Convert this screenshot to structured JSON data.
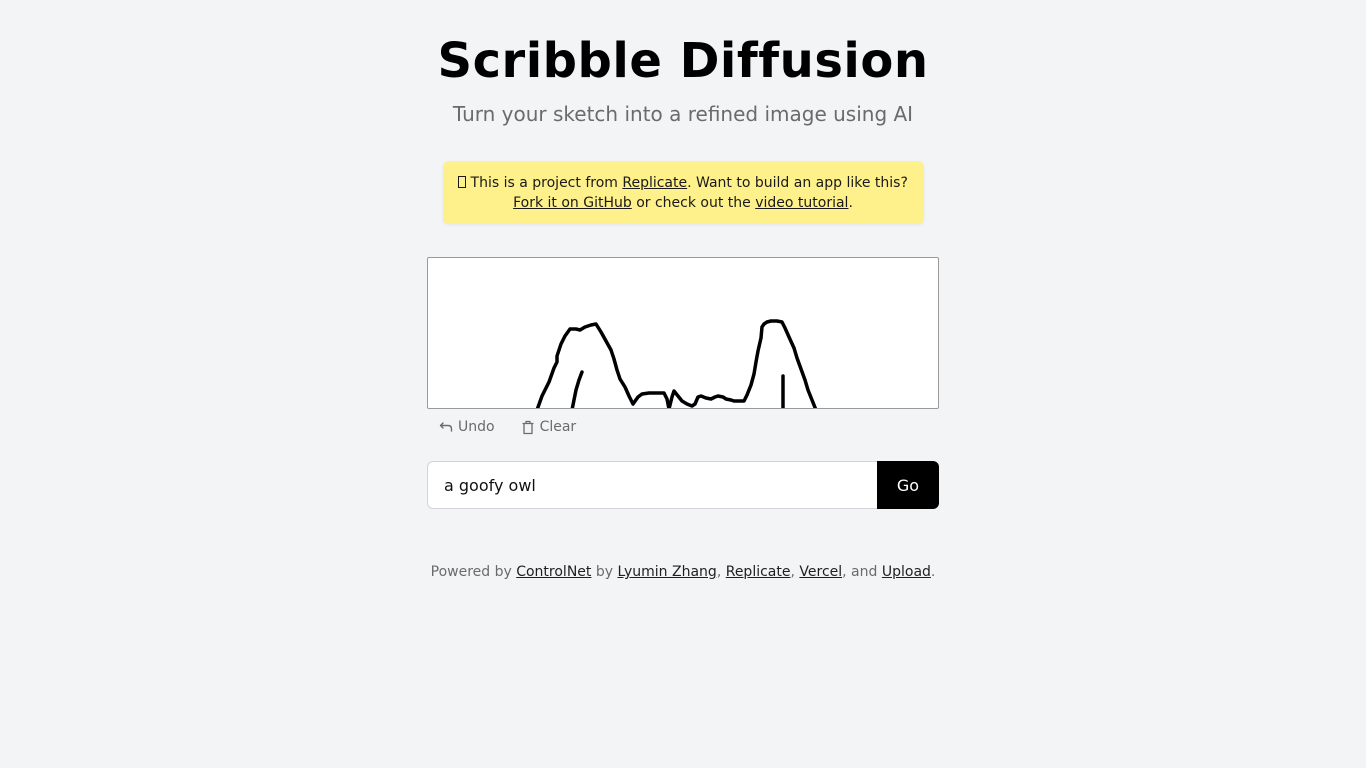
{
  "header": {
    "title": "Scribble Diffusion",
    "subtitle": "Turn your sketch into a refined image using AI"
  },
  "banner": {
    "icon": "missing-glyph-box",
    "text_before": " This is a project from ",
    "replicate_link": "Replicate",
    "text_middle": ". Want to build an app like this?",
    "fork_link": "Fork it on GitHub",
    "text_or": " or check out the ",
    "video_link": "video tutorial",
    "text_end": "."
  },
  "canvas": {
    "stroke_color": "#000000",
    "background": "#ffffff"
  },
  "tools": {
    "undo_label": "Undo",
    "undo_icon": "undo-arrow-icon",
    "clear_label": "Clear",
    "clear_icon": "trash-icon"
  },
  "prompt": {
    "value": "a goofy owl",
    "go_label": "Go"
  },
  "footer": {
    "powered_by": "Powered by ",
    "controlnet": "ControlNet",
    "by": " by ",
    "author": "Lyumin Zhang",
    "sep1": ", ",
    "replicate": "Replicate",
    "sep2": ", ",
    "vercel": "Vercel",
    "and": ", and ",
    "upload": "Upload",
    "end": "."
  },
  "colors": {
    "background": "#f3f4f6",
    "banner": "#fef08a",
    "button": "#000000",
    "muted_text": "#6b6b6b"
  }
}
